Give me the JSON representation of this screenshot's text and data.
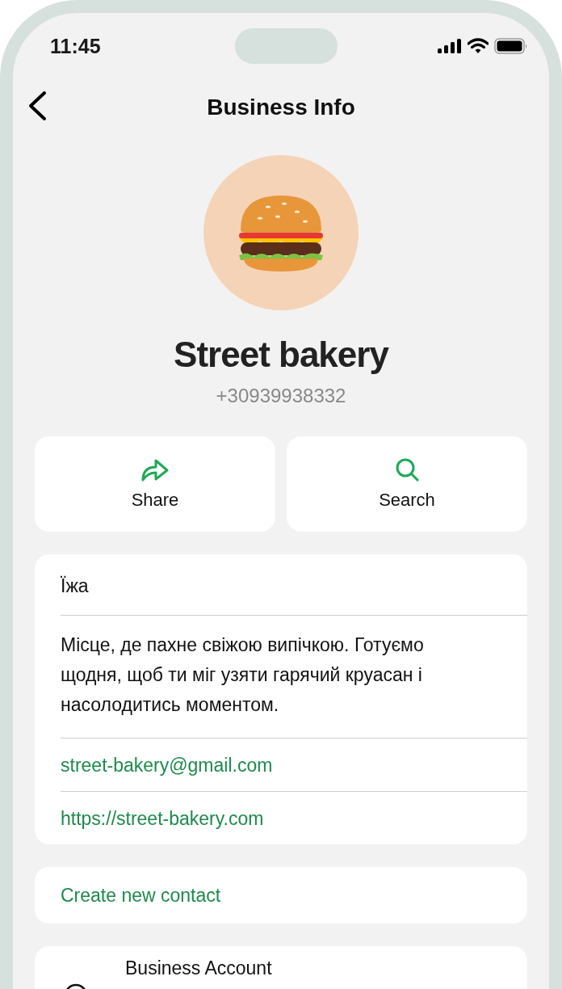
{
  "status_bar": {
    "time": "11:45"
  },
  "nav": {
    "title": "Business Info"
  },
  "profile": {
    "name": "Street bakery",
    "phone": "+30939938332"
  },
  "actions": [
    {
      "kind": "share",
      "label": "Share"
    },
    {
      "kind": "search",
      "label": "Search"
    }
  ],
  "info": {
    "category": "Їжа",
    "description": "Місце, де пахне свіжою випічкою. Готуємо щодня, щоб ти міг узяти гарячий круасан і насолодитись моментом.",
    "email": "street-bakery@gmail.com",
    "website": "https://street-bakery.com"
  },
  "create_contact": "Create new contact",
  "business_account": {
    "title": "Business Account"
  }
}
